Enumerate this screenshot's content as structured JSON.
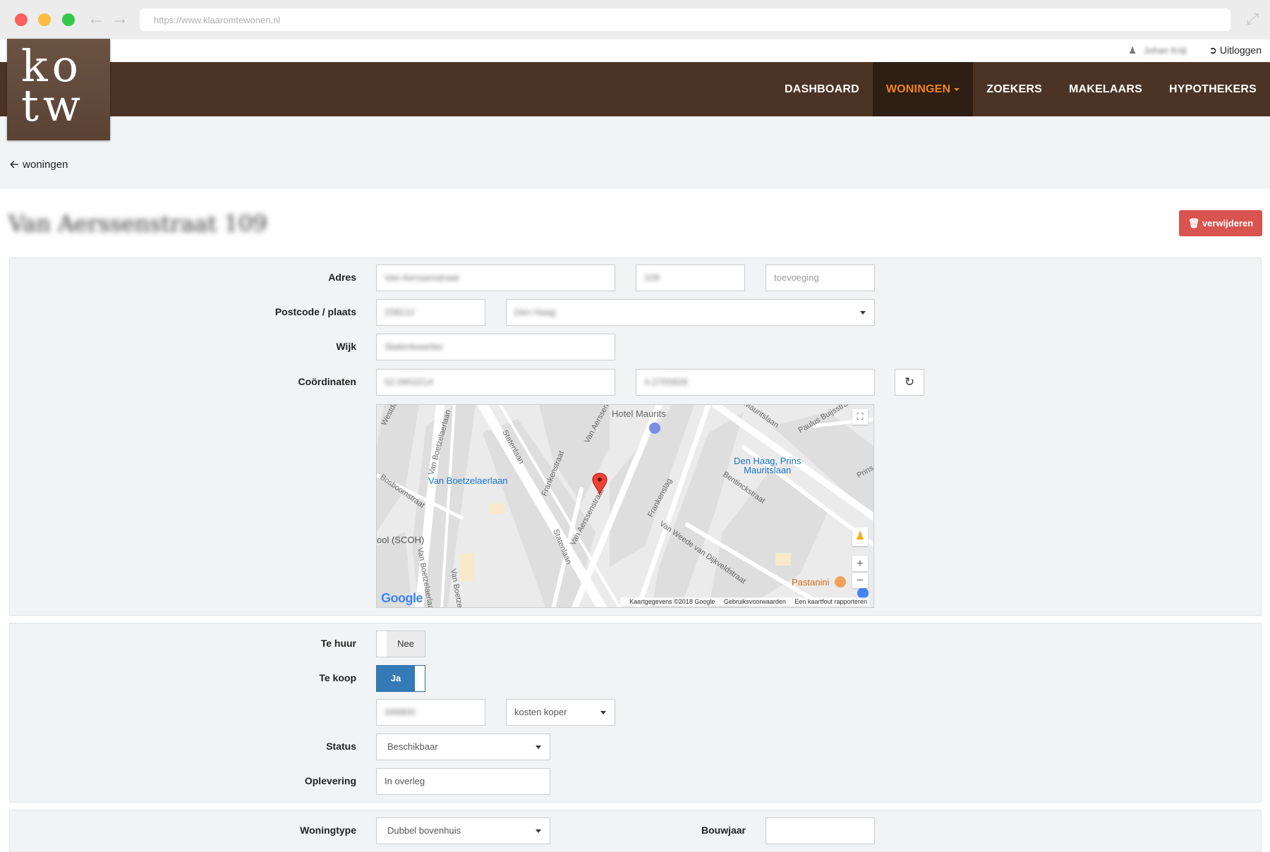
{
  "browser": {
    "url": "https://www.klaaromtewonen.nl"
  },
  "userbar": {
    "username": "Johan Krijt",
    "logout_label": "Uitloggen"
  },
  "logo": {
    "line1": "ko",
    "line2": "tw"
  },
  "nav": {
    "items": [
      {
        "label": "DASHBOARD",
        "active": false
      },
      {
        "label": "WONINGEN",
        "active": true
      },
      {
        "label": "ZOEKERS",
        "active": false
      },
      {
        "label": "MAKELAARS",
        "active": false
      },
      {
        "label": "HYPOTHEKERS",
        "active": false
      }
    ]
  },
  "breadcrumb": {
    "back_label": "woningen"
  },
  "page": {
    "title": "Van Aerssenstraat 109",
    "delete_label": "verwijderen"
  },
  "address": {
    "adres_label": "Adres",
    "street": "Van Aerssenstraat",
    "number": "109",
    "addition_placeholder": "toevoeging",
    "postcode_label": "Postcode / plaats",
    "postcode": "2582JJ",
    "city": "Den Haag",
    "wijk_label": "Wijk",
    "wijk": "Statenkwartier",
    "coords_label": "Coördinaten",
    "lat": "52.0952214",
    "lng": "4.2755828"
  },
  "map": {
    "labels": {
      "hotel": "Hotel Maurits",
      "station1": "Van Boetzelaerlaan",
      "station2_line1": "Den Haag, Prins",
      "station2_line2": "Mauritslaan",
      "school": "ool (SCOH)",
      "restaurant": "Pastanini"
    },
    "streets": [
      "Statenlaan",
      "Statenlaan",
      "Frankenstraat",
      "Van Aerssenstraat",
      "Frankenslag",
      "Bentinckstraat",
      "Van Weede van Dijkveldstraat",
      "Mauritslaan",
      "Paulus Buijsstraat",
      "Van Boetzelaerlaan",
      "Bosboomstraat",
      "Westduinweg",
      "Van Aerssenstraat",
      "Prins",
      "Van Boetzelaerlaan",
      "Van Boetzelaerlaan"
    ],
    "google": "Google",
    "attribution": [
      "Kaartgegevens ©2018 Google",
      "Gebruiksvoorwaarden",
      "Een kaartfout rapporteren"
    ]
  },
  "sale": {
    "te_huur_label": "Te huur",
    "te_huur_value": "Nee",
    "te_koop_label": "Te koop",
    "te_koop_value": "Ja",
    "price": "349900",
    "price_type": "kosten koper",
    "status_label": "Status",
    "status": "Beschikbaar",
    "oplevering_label": "Oplevering",
    "oplevering": "In overleg"
  },
  "details": {
    "woningtype_label": "Woningtype",
    "woningtype": "Dubbel bovenhuis",
    "bouwjaar_label": "Bouwjaar",
    "bouwjaar": ""
  }
}
